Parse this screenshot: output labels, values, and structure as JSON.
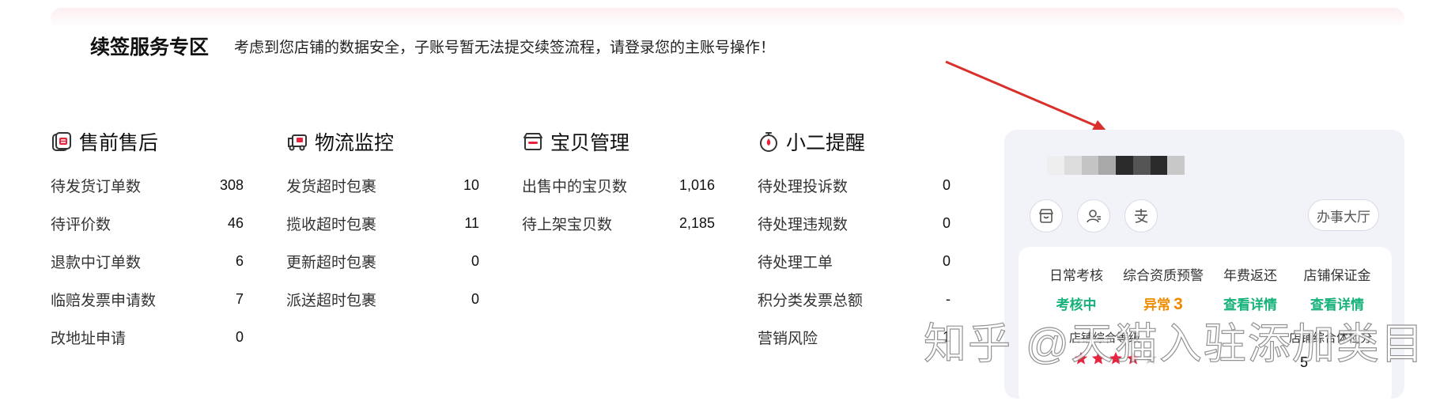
{
  "renew": {
    "title": "续签服务专区",
    "notice": "考虑到您店铺的数据安全，子账号暂无法提交续签流程，请登录您的主账号操作！"
  },
  "sections": [
    {
      "title": "售前售后",
      "icon": "service-doc-icon",
      "items": [
        {
          "label": "待发货订单数",
          "value": "308"
        },
        {
          "label": "待评价数",
          "value": "46"
        },
        {
          "label": "退款中订单数",
          "value": "6"
        },
        {
          "label": "临赔发票申请数",
          "value": "7"
        },
        {
          "label": "改地址申请",
          "value": "0"
        }
      ]
    },
    {
      "title": "物流监控",
      "icon": "delivery-truck-icon",
      "items": [
        {
          "label": "发货超时包裹",
          "value": "10"
        },
        {
          "label": "揽收超时包裹",
          "value": "11"
        },
        {
          "label": "更新超时包裹",
          "value": "0"
        },
        {
          "label": "派送超时包裹",
          "value": "0"
        }
      ]
    },
    {
      "title": "宝贝管理",
      "icon": "store-icon",
      "items": [
        {
          "label": "出售中的宝贝数",
          "value": "1,016"
        },
        {
          "label": "待上架宝贝数",
          "value": "2,185"
        }
      ]
    },
    {
      "title": "小二提醒",
      "icon": "stopwatch-icon",
      "items": [
        {
          "label": "待处理投诉数",
          "value": "0"
        },
        {
          "label": "待处理违规数",
          "value": "0"
        },
        {
          "label": "待处理工单",
          "value": "0"
        },
        {
          "label": "积分类发票总额",
          "value": "-"
        },
        {
          "label": "营销风险",
          "value": "1"
        }
      ]
    }
  ],
  "panel": {
    "hall_label": "办事大厅",
    "stats": [
      {
        "label": "日常考核",
        "status": "考核中",
        "color": "#16b27a"
      },
      {
        "label": "综合资质预警",
        "status": "异常",
        "count": "3",
        "color": "#f08a00"
      },
      {
        "label": "年费返还",
        "status": "查看详情",
        "color": "#16b27a"
      },
      {
        "label": "店铺保证金",
        "status": "查看详情",
        "color": "#16b27a"
      }
    ],
    "level_label": "店铺综合等级",
    "rating": 4,
    "rating_max": 5,
    "exam_label": "店铺综合体检分",
    "exam_score": "5"
  },
  "watermark": "知乎 @天猫入驻添加类目",
  "colors": {
    "accent_red": "#e8233d",
    "green": "#16b27a",
    "orange": "#f08a00",
    "arrow": "#d9302c"
  }
}
